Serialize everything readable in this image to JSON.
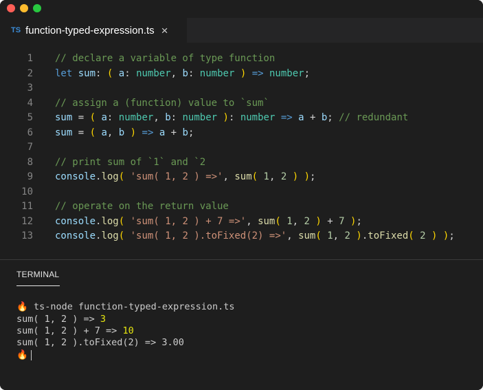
{
  "window": {
    "colors": {
      "red": "#ff5f57",
      "yellow": "#febc2e",
      "green": "#28c840"
    }
  },
  "tab": {
    "lang_badge": "TS",
    "filename": "function-typed-expression.ts",
    "close_glyph": "×"
  },
  "editor": {
    "lines": [
      {
        "n": "1",
        "tokens": [
          [
            "c",
            "// declare a variable of type function"
          ]
        ]
      },
      {
        "n": "2",
        "tokens": [
          [
            "k",
            "let"
          ],
          [
            "o",
            " "
          ],
          [
            "v",
            "sum"
          ],
          [
            "o",
            ": "
          ],
          [
            "p",
            "("
          ],
          [
            "o",
            " "
          ],
          [
            "v",
            "a"
          ],
          [
            "o",
            ": "
          ],
          [
            "t",
            "number"
          ],
          [
            "o",
            ", "
          ],
          [
            "v",
            "b"
          ],
          [
            "o",
            ": "
          ],
          [
            "t",
            "number"
          ],
          [
            "o",
            " "
          ],
          [
            "p",
            ")"
          ],
          [
            "o",
            " "
          ],
          [
            "a",
            "=>"
          ],
          [
            "o",
            " "
          ],
          [
            "t",
            "number"
          ],
          [
            "o",
            ";"
          ]
        ]
      },
      {
        "n": "3",
        "tokens": []
      },
      {
        "n": "4",
        "tokens": [
          [
            "c",
            "// assign a (function) value to `sum`"
          ]
        ]
      },
      {
        "n": "5",
        "tokens": [
          [
            "v",
            "sum"
          ],
          [
            "o",
            " = "
          ],
          [
            "p",
            "("
          ],
          [
            "o",
            " "
          ],
          [
            "v",
            "a"
          ],
          [
            "o",
            ": "
          ],
          [
            "t",
            "number"
          ],
          [
            "o",
            ", "
          ],
          [
            "v",
            "b"
          ],
          [
            "o",
            ": "
          ],
          [
            "t",
            "number"
          ],
          [
            "o",
            " "
          ],
          [
            "p",
            ")"
          ],
          [
            "o",
            ": "
          ],
          [
            "t",
            "number"
          ],
          [
            "o",
            " "
          ],
          [
            "a",
            "=>"
          ],
          [
            "o",
            " "
          ],
          [
            "v",
            "a"
          ],
          [
            "o",
            " + "
          ],
          [
            "v",
            "b"
          ],
          [
            "o",
            "; "
          ],
          [
            "c",
            "// redundant"
          ]
        ]
      },
      {
        "n": "6",
        "tokens": [
          [
            "v",
            "sum"
          ],
          [
            "o",
            " = "
          ],
          [
            "p",
            "("
          ],
          [
            "o",
            " "
          ],
          [
            "v",
            "a"
          ],
          [
            "o",
            ", "
          ],
          [
            "v",
            "b"
          ],
          [
            "o",
            " "
          ],
          [
            "p",
            ")"
          ],
          [
            "o",
            " "
          ],
          [
            "a",
            "=>"
          ],
          [
            "o",
            " "
          ],
          [
            "v",
            "a"
          ],
          [
            "o",
            " + "
          ],
          [
            "v",
            "b"
          ],
          [
            "o",
            ";"
          ]
        ]
      },
      {
        "n": "7",
        "tokens": []
      },
      {
        "n": "8",
        "tokens": [
          [
            "c",
            "// print sum of `1` and `2"
          ]
        ]
      },
      {
        "n": "9",
        "tokens": [
          [
            "v",
            "console"
          ],
          [
            "o",
            "."
          ],
          [
            "f",
            "log"
          ],
          [
            "p",
            "("
          ],
          [
            "o",
            " "
          ],
          [
            "s",
            "'sum( 1, 2 ) =>'"
          ],
          [
            "o",
            ", "
          ],
          [
            "f",
            "sum"
          ],
          [
            "p",
            "("
          ],
          [
            "o",
            " "
          ],
          [
            "n",
            "1"
          ],
          [
            "o",
            ", "
          ],
          [
            "n",
            "2"
          ],
          [
            "o",
            " "
          ],
          [
            "p",
            ")"
          ],
          [
            "o",
            " "
          ],
          [
            "p",
            ")"
          ],
          [
            "o",
            ";"
          ]
        ]
      },
      {
        "n": "10",
        "tokens": []
      },
      {
        "n": "11",
        "tokens": [
          [
            "c",
            "// operate on the return value"
          ]
        ]
      },
      {
        "n": "12",
        "tokens": [
          [
            "v",
            "console"
          ],
          [
            "o",
            "."
          ],
          [
            "f",
            "log"
          ],
          [
            "p",
            "("
          ],
          [
            "o",
            " "
          ],
          [
            "s",
            "'sum( 1, 2 ) + 7 =>'"
          ],
          [
            "o",
            ", "
          ],
          [
            "f",
            "sum"
          ],
          [
            "p",
            "("
          ],
          [
            "o",
            " "
          ],
          [
            "n",
            "1"
          ],
          [
            "o",
            ", "
          ],
          [
            "n",
            "2"
          ],
          [
            "o",
            " "
          ],
          [
            "p",
            ")"
          ],
          [
            "o",
            " + "
          ],
          [
            "n",
            "7"
          ],
          [
            "o",
            " "
          ],
          [
            "p",
            ")"
          ],
          [
            "o",
            ";"
          ]
        ]
      },
      {
        "n": "13",
        "tokens": [
          [
            "v",
            "console"
          ],
          [
            "o",
            "."
          ],
          [
            "f",
            "log"
          ],
          [
            "p",
            "("
          ],
          [
            "o",
            " "
          ],
          [
            "s",
            "'sum( 1, 2 ).toFixed(2) =>'"
          ],
          [
            "o",
            ", "
          ],
          [
            "f",
            "sum"
          ],
          [
            "p",
            "("
          ],
          [
            "o",
            " "
          ],
          [
            "n",
            "1"
          ],
          [
            "o",
            ", "
          ],
          [
            "n",
            "2"
          ],
          [
            "o",
            " "
          ],
          [
            "p",
            ")"
          ],
          [
            "o",
            "."
          ],
          [
            "f",
            "toFixed"
          ],
          [
            "p",
            "("
          ],
          [
            "o",
            " "
          ],
          [
            "n",
            "2"
          ],
          [
            "o",
            " "
          ],
          [
            "p",
            ")"
          ],
          [
            "o",
            " "
          ],
          [
            "p",
            ")"
          ],
          [
            "o",
            ";"
          ]
        ]
      }
    ]
  },
  "panel": {
    "tab_label": "TERMINAL",
    "prompt_icon": "🔥",
    "command": "ts-node function-typed-expression.ts",
    "output": [
      {
        "text": "sum( 1, 2 ) => ",
        "value": "3"
      },
      {
        "text": "sum( 1, 2 ) + 7 => ",
        "value": "10"
      },
      {
        "text": "sum( 1, 2 ).toFixed(2) => 3.00",
        "value": ""
      }
    ]
  }
}
